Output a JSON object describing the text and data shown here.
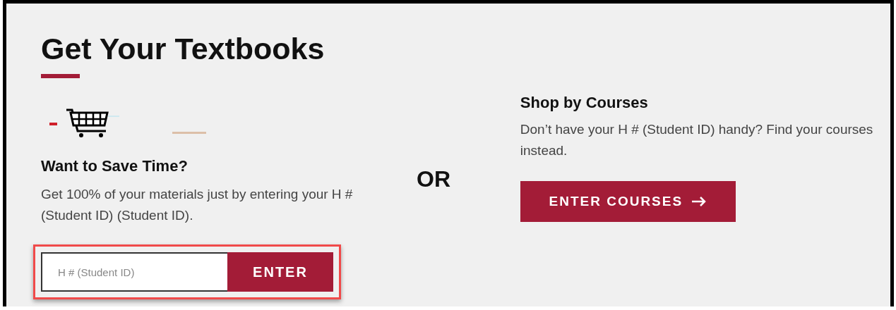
{
  "title": "Get Your Textbooks",
  "save_time": {
    "heading": "Want to Save Time?",
    "text": "Get 100% of your materials just by entering your H # (Student ID) (Student ID).",
    "input": {
      "placeholder": "H # (Student ID)"
    },
    "button": "ENTER"
  },
  "divider_text": "OR",
  "courses": {
    "heading": "Shop by Courses",
    "text": "Don’t have your H # (Student ID) handy? Find your courses instead.",
    "button": "ENTER COURSES"
  }
}
